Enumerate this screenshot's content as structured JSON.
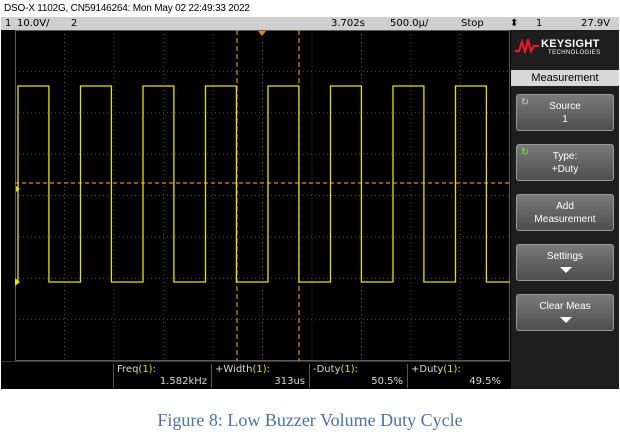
{
  "header": {
    "text": "DSO-X 1102G, CN59146264: Mon May 02 22:49:33 2022"
  },
  "status_bar": {
    "ch1_num": "1",
    "ch1_scale": "10.0V/",
    "ch2_num": "2",
    "time_pos": "3.702s",
    "time_scale": "500.0µ/",
    "run_state": "Stop",
    "trigger_symbol": "⬍",
    "trigger_source": "1",
    "trigger_level": "27.9V"
  },
  "scope": {
    "colors": {
      "ch1": "#e8e000",
      "ch2": "#26c426",
      "cursor": "#e8861a",
      "grid": "#4a4a4a",
      "panel": "#1e1e1e"
    },
    "markers": {
      "trigger_marker": "T",
      "ground_marker": "1"
    },
    "signal": {
      "type": "square",
      "duty_fraction": 0.495,
      "cycles_visible": 8
    }
  },
  "panel": {
    "brand": "KEYSIGHT",
    "brand_sub": "TECHNOLOGIES",
    "title": "Measurement",
    "softkeys": [
      {
        "line1": "Source",
        "line2": "1"
      },
      {
        "line1": "Type:",
        "line2": "+Duty"
      },
      {
        "line1": "Add",
        "line2": "Measurement"
      },
      {
        "line1": "Settings",
        "line2": ""
      },
      {
        "line1": "Clear Meas",
        "line2": ""
      }
    ]
  },
  "measurements": [
    {
      "name": "Freq",
      "ch": "(1)",
      "value": "1.582kHz"
    },
    {
      "name": "+Width",
      "ch": "(1)",
      "value": "313us"
    },
    {
      "name": "-Duty",
      "ch": "(1)",
      "value": "50.5%"
    },
    {
      "name": "+Duty",
      "ch": "(1)",
      "value": "49.5%"
    }
  ],
  "caption": "Figure 8: Low Buzzer Volume Duty Cycle"
}
